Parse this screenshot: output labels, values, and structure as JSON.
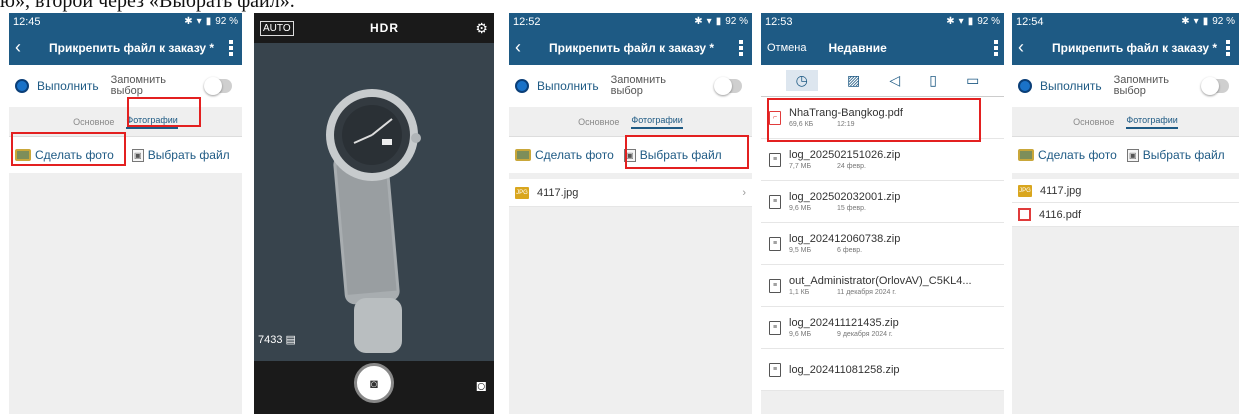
{
  "caption": "ю», второй через «Выбрать файл».",
  "status": {
    "s1_time": "12:45",
    "s3_time": "12:52",
    "s4_time": "12:53",
    "s5_time": "12:54",
    "battery": "92 %"
  },
  "app": {
    "title": "Прикрепить файл к заказу *",
    "execute": "Выполнить",
    "remember_line1": "Запомнить",
    "remember_line2": "выбор",
    "tab_main": "Основное",
    "tab_photos": "Фотографии",
    "take_photo": "Сделать фото",
    "choose_file": "Выбрать файл"
  },
  "screen3": {
    "files": [
      {
        "name": "4117.jpg"
      }
    ]
  },
  "screen5": {
    "files": [
      {
        "name": "4117.jpg",
        "type": "jpg"
      },
      {
        "name": "4116.pdf",
        "type": "pdf"
      }
    ]
  },
  "camera": {
    "auto": "AUTO",
    "hdr": "HDR",
    "counter": "7433"
  },
  "picker": {
    "cancel": "Отмена",
    "title": "Недавние",
    "files": [
      {
        "name": "NhaTrang-Bangkog.pdf",
        "size": "69,6 КБ",
        "date": "12:19"
      },
      {
        "name": "log_202502151026.zip",
        "size": "7,7 МБ",
        "date": "24 февр."
      },
      {
        "name": "log_202502032001.zip",
        "size": "9,6 МБ",
        "date": "15 февр."
      },
      {
        "name": "log_202412060738.zip",
        "size": "9,5 МБ",
        "date": "6 февр."
      },
      {
        "name": "out_Administrator(OrlovAV)_C5KL4...",
        "size": "1,1 КБ",
        "date": "11 декабря 2024 г."
      },
      {
        "name": "log_202411121435.zip",
        "size": "9,6 МБ",
        "date": "9 декабря 2024 г."
      },
      {
        "name": "log_202411081258.zip",
        "size": "",
        "date": ""
      }
    ]
  }
}
